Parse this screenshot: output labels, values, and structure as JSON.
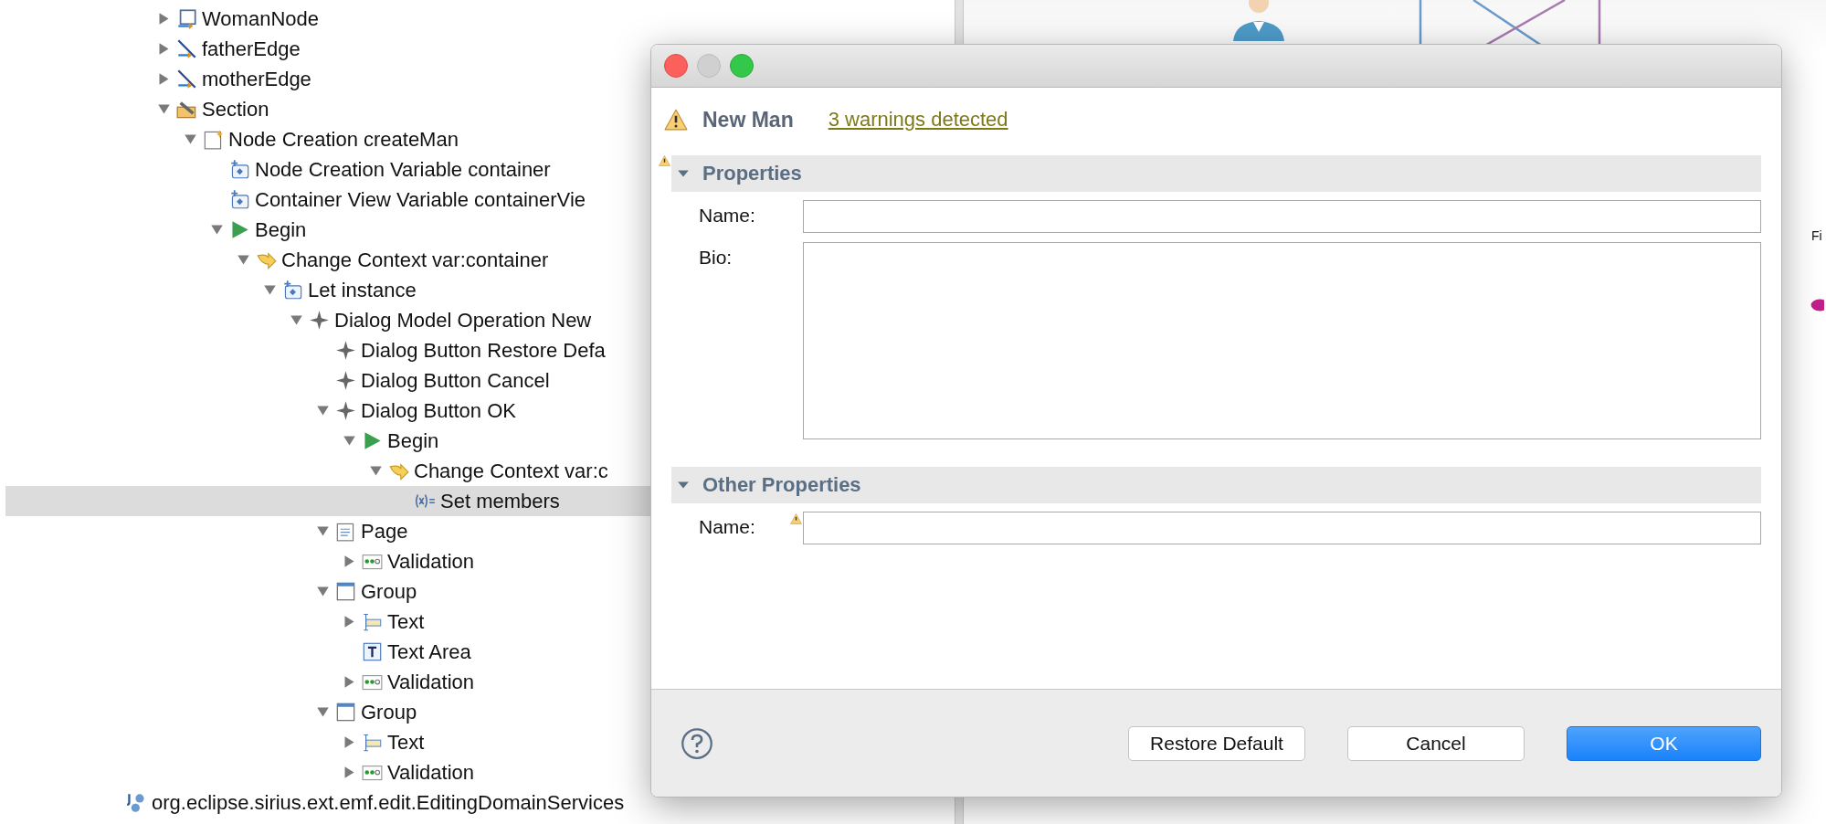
{
  "tree": {
    "items": [
      {
        "label": "WomanNode",
        "kind": "node",
        "expanded": false,
        "selected": false
      },
      {
        "label": "fatherEdge",
        "kind": "edge",
        "expanded": false,
        "selected": false
      },
      {
        "label": "motherEdge",
        "kind": "edge",
        "expanded": false,
        "selected": false
      },
      {
        "label": "Section",
        "kind": "section",
        "expanded": true,
        "selected": false,
        "children": [
          {
            "label": "Node Creation createMan",
            "kind": "creation",
            "expanded": true,
            "selected": false,
            "children": [
              {
                "label": "Node Creation Variable container",
                "kind": "variable",
                "selected": false
              },
              {
                "label": "Container View Variable containerVie",
                "kind": "variable",
                "selected": false
              },
              {
                "label": "Begin",
                "kind": "begin",
                "expanded": true,
                "selected": false,
                "children": [
                  {
                    "label": "Change Context var:container",
                    "kind": "context",
                    "expanded": true,
                    "selected": false,
                    "children": [
                      {
                        "label": "Let instance",
                        "kind": "let",
                        "expanded": true,
                        "selected": false,
                        "children": [
                          {
                            "label": "Dialog Model Operation New",
                            "kind": "dialog",
                            "expanded": true,
                            "selected": false,
                            "children": [
                              {
                                "label": "Dialog Button Restore Defa",
                                "kind": "dialog",
                                "selected": false
                              },
                              {
                                "label": "Dialog Button Cancel",
                                "kind": "dialog",
                                "selected": false
                              },
                              {
                                "label": "Dialog Button OK",
                                "kind": "dialog",
                                "expanded": true,
                                "selected": false,
                                "children": [
                                  {
                                    "label": "Begin",
                                    "kind": "begin",
                                    "expanded": true,
                                    "selected": false,
                                    "children": [
                                      {
                                        "label": "Change Context var:c",
                                        "kind": "context",
                                        "expanded": true,
                                        "selected": false,
                                        "children": [
                                          {
                                            "label": "Set members",
                                            "kind": "set",
                                            "selected": true
                                          }
                                        ]
                                      }
                                    ]
                                  }
                                ]
                              },
                              {
                                "label": "Page",
                                "kind": "page",
                                "expanded": true,
                                "selected": false,
                                "children": [
                                  {
                                    "label": "Validation",
                                    "kind": "validation",
                                    "expanded": false,
                                    "selected": false
                                  }
                                ]
                              },
                              {
                                "label": "Group",
                                "kind": "group",
                                "expanded": true,
                                "selected": false,
                                "children": [
                                  {
                                    "label": "Text",
                                    "kind": "text",
                                    "expanded": false,
                                    "selected": false
                                  },
                                  {
                                    "label": "Text Area",
                                    "kind": "textarea",
                                    "selected": false
                                  },
                                  {
                                    "label": "Validation",
                                    "kind": "validation",
                                    "expanded": false,
                                    "selected": false
                                  }
                                ]
                              },
                              {
                                "label": "Group",
                                "kind": "group",
                                "expanded": true,
                                "selected": false,
                                "children": [
                                  {
                                    "label": "Text",
                                    "kind": "text",
                                    "expanded": false,
                                    "selected": false
                                  },
                                  {
                                    "label": "Validation",
                                    "kind": "validation",
                                    "expanded": false,
                                    "selected": false
                                  }
                                ]
                              }
                            ]
                          }
                        ]
                      }
                    ]
                  }
                ]
              }
            ]
          }
        ]
      }
    ],
    "after_items": [
      {
        "label": "org.eclipse.sirius.ext.emf.edit.EditingDomainServices",
        "kind": "java",
        "selected": false
      }
    ]
  },
  "canvas": {
    "label": "Fi"
  },
  "dialog": {
    "heading": "New Man",
    "warning_link": "3 warnings detected",
    "sections": [
      {
        "title": "Properties",
        "expanded": true,
        "warning": true,
        "fields": [
          {
            "kind": "text",
            "label": "Name:",
            "warning": false
          },
          {
            "kind": "textarea",
            "label": "Bio:",
            "warning": false
          }
        ]
      },
      {
        "title": "Other Properties",
        "expanded": true,
        "warning": false,
        "fields": [
          {
            "kind": "text",
            "label": "Name:",
            "warning": true
          }
        ]
      }
    ],
    "buttons": [
      {
        "label": "Restore Default",
        "default": false
      },
      {
        "label": "Cancel",
        "default": false
      },
      {
        "label": "OK",
        "default": true
      }
    ]
  }
}
